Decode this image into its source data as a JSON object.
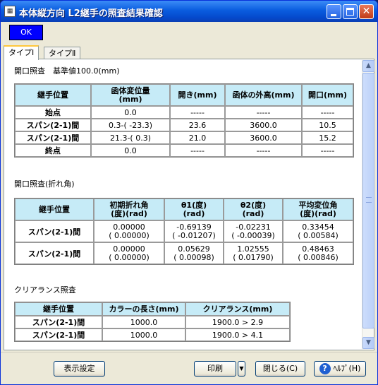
{
  "window": {
    "title": "本体縦方向 L2継手の照査結果確認",
    "icon_name": "app-grid-icon",
    "accent_color": "#0a5ddf"
  },
  "toolbar": {
    "ok_label": "OK"
  },
  "tabs": [
    {
      "label": "タイプⅠ",
      "active": true
    },
    {
      "label": "タイプⅡ",
      "active": false
    }
  ],
  "section1": {
    "title": "開口照査　基準値100.0(mm)",
    "headers": [
      "継手位置",
      "函体変位量\n(mm)",
      "開き(mm)",
      "函体の外高(mm)",
      "開口(mm)"
    ],
    "rows": [
      [
        "始点",
        "0.0",
        "-----",
        "-----",
        "-----"
      ],
      [
        "スパン(2-1)間",
        "0.3-( -23.3)",
        "23.6",
        "3600.0",
        "10.5"
      ],
      [
        "スパン(2-1)間",
        "21.3-( 0.3)",
        "21.0",
        "3600.0",
        "15.2"
      ],
      [
        "終点",
        "0.0",
        "-----",
        "-----",
        "-----"
      ]
    ]
  },
  "section2": {
    "title": "開口照査(折れ角)",
    "headers": [
      "継手位置",
      "初期折れ角\n(度)(rad)",
      "θ1(度)\n(rad)",
      "θ2(度)\n(rad)",
      "平均変位角\n(度)(rad)"
    ],
    "rows": [
      [
        "スパン(2-1)間",
        "0.00000\n( 0.00000)",
        "-0.69139\n( -0.01207)",
        "-0.02231\n( -0.00039)",
        "0.33454\n( 0.00584)"
      ],
      [
        "スパン(2-1)間",
        "0.00000\n( 0.00000)",
        "0.05629\n( 0.00098)",
        "1.02555\n( 0.01790)",
        "0.48463\n( 0.00846)"
      ]
    ]
  },
  "section3": {
    "title": "クリアランス照査",
    "headers": [
      "継手位置",
      "カラーの長さ(mm)",
      "クリアランス(mm)"
    ],
    "rows": [
      [
        "スパン(2-1)間",
        "1000.0",
        "1900.0 > 2.9"
      ],
      [
        "スパン(2-1)間",
        "1000.0",
        "1900.0 > 4.1"
      ]
    ]
  },
  "buttons": {
    "display_settings": "表示設定",
    "print": "印刷",
    "close": "閉じる(C)",
    "help": "ﾍﾙﾌﾟ(H)"
  },
  "colors": {
    "header_bg": "#c6ebf7",
    "ok_bg": "#0000ff"
  }
}
